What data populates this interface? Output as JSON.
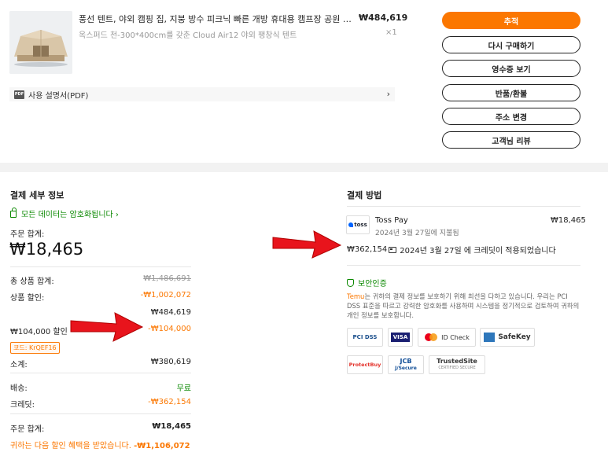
{
  "product": {
    "title": "풍선 텐트, 야외 캠핑 집, 지붕 방수 피크닉 빠른 개방 휴대용 캠프장 공원 캠핑 ...",
    "price": "₩484,619",
    "variant": "옥스퍼드 천-300*400cm를 갖춘 Cloud Air12 야외 팽창식 텐트",
    "quantity": "×1",
    "manual_label": "사용 설명서(PDF)",
    "manual_chevron": "›"
  },
  "actions": {
    "track": "추적",
    "rebuy": "다시 구매하기",
    "receipt": "영수증 보기",
    "return_refund": "반품/환불",
    "change_address": "주소 변경",
    "review": "고객님 리뷰"
  },
  "payment_details": {
    "title": "결제 세부 정보",
    "encrypted": "모든 데이터는 암호화됩니다 ›",
    "order_total_label": "주문 합계:",
    "order_total_big": "₩18,465",
    "rows": {
      "items_total_label": "총 상품 합계:",
      "items_total_value": "₩1,486,691",
      "item_discount_label": "상품 할인:",
      "item_discount_value": "-₩1,002,072",
      "subtotal_after_discount": "₩484,619",
      "coupon_label": "₩104,000 할인",
      "coupon_value": "-₩104,000",
      "coupon_code": "코드: KrQEF16",
      "subtotal_label": "소계:",
      "subtotal_value": "₩380,619",
      "shipping_label": "배송:",
      "shipping_value": "무료",
      "credit_label": "크레딧:",
      "credit_value": "-₩362,154",
      "final_total_label": "주문 합계:",
      "final_total_value": "₩18,465",
      "saved_text": "귀하는 다음 할인 혜택을 받았습니다.",
      "saved_value": "-₩1,106,072"
    }
  },
  "payment_method": {
    "title": "결제 방법",
    "logo_text": "toss",
    "name": "Toss Pay",
    "amount": "₩18,465",
    "date": "2024년 3월 27일에 지불됨",
    "credit_amount": "₩362,154",
    "credit_text": "2024년 3월 27일 에 크레딧이 적용되었습니다",
    "security_title": "보안인증",
    "security_brand": "Temu",
    "security_desc": "는 귀하의 결제 정보를 보호하기 위해 최선을 다하고 있습니다. 우리는 PCI DSS 표준을 따르고 강력한 암호화를 사용하며 시스템을 정기적으로 검토하여 귀하의 개인 정보를 보호합니다.",
    "badges": {
      "pci": "PCI DSS",
      "visa": "VISA",
      "idcheck": "ID Check",
      "safekey": "SafeKey",
      "protectbuy": "ProtectBuy",
      "jcb": "JCB",
      "jcb_sub": "J/Secure",
      "trustedsite": "TrustedSite",
      "trustedsite_sub": "CERTIFIED SECURE"
    }
  },
  "colors": {
    "accent": "#fb7701",
    "green": "#0a8800",
    "arrow_red": "#e8141c"
  }
}
